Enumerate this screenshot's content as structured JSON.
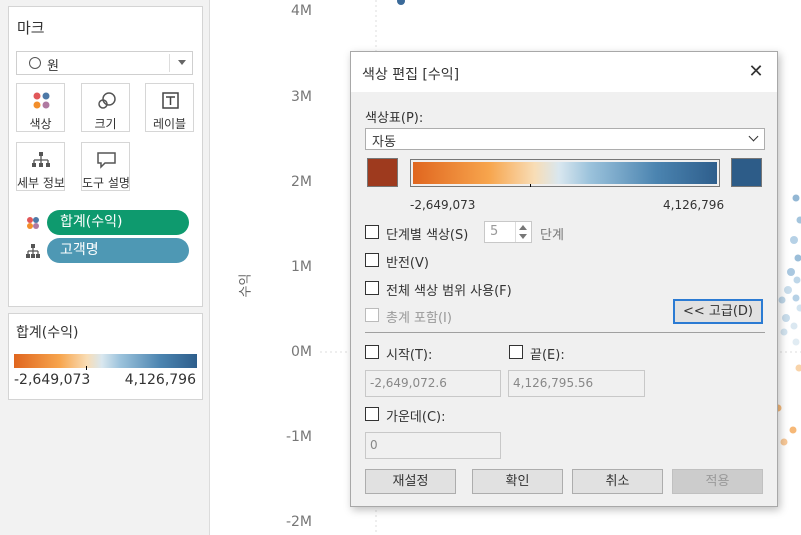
{
  "marks": {
    "title": "마크",
    "mark_type": "원",
    "buttons": {
      "color": "색상",
      "size": "크기",
      "label": "레이블",
      "detail": "세부 정보",
      "tooltip": "도구 설명"
    },
    "pills": [
      {
        "label": "합계(수익)",
        "color": "#0e9a6e"
      },
      {
        "label": "고객명",
        "color": "#4e98b4"
      }
    ]
  },
  "legend": {
    "title": "합계(수익)",
    "min_label": "-2,649,073",
    "max_label": "4,126,796"
  },
  "axis": {
    "ticks": [
      "4M",
      "3M",
      "2M",
      "1M",
      "0M",
      "-1M",
      "-2M"
    ],
    "label": "수익"
  },
  "dialog": {
    "title": "색상 편집 [수익]",
    "palette_label": "색상표(P):",
    "palette_value": "자동",
    "colors": {
      "start": "#9e3a1e",
      "end": "#2d5c88"
    },
    "range_min": "-2,649,073",
    "range_max": "4,126,796",
    "stepped_label": "단계별 색상(S)",
    "steps_value": "5",
    "steps_unit": "단계",
    "reverse_label": "반전(V)",
    "full_range_label": "전체 색상 범위 사용(F)",
    "include_totals_label": "총계 포함(I)",
    "advanced_button": "<< 고급(D)",
    "start_label": "시작(T):",
    "start_value": "-2,649,072.6",
    "end_label": "끝(E):",
    "end_value": "4,126,795.56",
    "center_label": "가운데(C):",
    "center_value": "0",
    "buttons": {
      "reset": "재설정",
      "ok": "확인",
      "cancel": "취소",
      "apply": "적용"
    }
  }
}
